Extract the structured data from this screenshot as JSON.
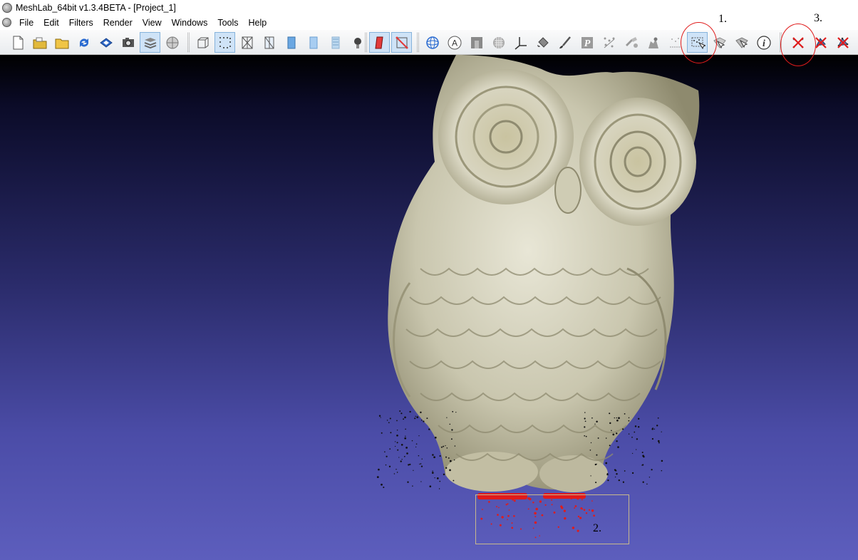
{
  "window": {
    "title": "MeshLab_64bit v1.3.4BETA - [Project_1]"
  },
  "menu": [
    {
      "id": "file",
      "label": "File"
    },
    {
      "id": "edit",
      "label": "Edit"
    },
    {
      "id": "filters",
      "label": "Filters"
    },
    {
      "id": "render",
      "label": "Render"
    },
    {
      "id": "view",
      "label": "View"
    },
    {
      "id": "windows",
      "label": "Windows"
    },
    {
      "id": "tools",
      "label": "Tools"
    },
    {
      "id": "help",
      "label": "Help"
    }
  ],
  "toolbar": {
    "icons": [
      "new-project-icon",
      "open-project-icon",
      "open-mesh-icon",
      "reload-icon",
      "save-icon",
      "snapshot-icon",
      "layers-icon",
      "decorate-icon",
      "bbox-icon",
      "points-icon",
      "wireframe-icon",
      "hidden-lines-icon",
      "flat-icon",
      "smooth-icon",
      "texture-icon",
      "light-icon",
      "backface-icon",
      "select-faces-icon",
      "trackball-icon",
      "annotation-icon",
      "raster-icon",
      "texture-param-icon",
      "measure-axes-icon",
      "paint-bucket-icon",
      "brush-icon",
      "pickpoints-icon",
      "align-icon",
      "manipulator-icon",
      "quality-map-icon",
      "reference-icon",
      "select-vertices-icon",
      "select-connected-icon",
      "select-z-icon",
      "info-icon",
      "delete-vertices-icon",
      "delete-faces-icon",
      "delete-faces-vertices-icon"
    ],
    "active": [
      "layers-icon",
      "points-icon",
      "backface-icon",
      "select-faces-icon",
      "select-vertices-icon"
    ]
  },
  "annotations": {
    "label_1": "1.",
    "label_2": "2.",
    "label_3": "3.",
    "color": "#e01b1b"
  }
}
